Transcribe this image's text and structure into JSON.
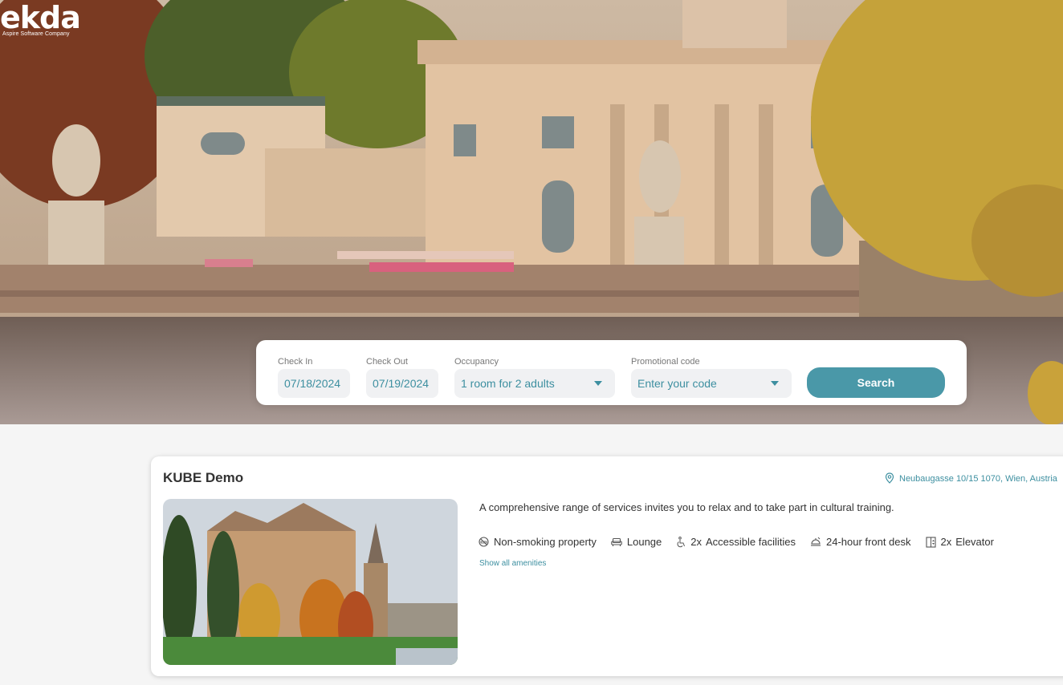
{
  "brand": {
    "wordmark": "ekda",
    "tagline": "Aspire Software Company"
  },
  "search": {
    "check_in": {
      "label": "Check In",
      "value": "07/18/2024"
    },
    "check_out": {
      "label": "Check Out",
      "value": "07/19/2024"
    },
    "occupancy": {
      "label": "Occupancy",
      "value": "1 room for 2 adults"
    },
    "promo": {
      "label": "Promotional code",
      "placeholder": "Enter your code"
    },
    "button_label": "Search"
  },
  "property": {
    "name": "KUBE Demo",
    "address": "Neubaugasse 10/15 1070, Wien, Austria",
    "description": "A comprehensive range of services invites you to relax and to take part in cultural training.",
    "amenities": [
      {
        "icon": "no-smoking-icon",
        "count": "",
        "label": "Non-smoking property"
      },
      {
        "icon": "sofa-icon",
        "count": "",
        "label": "Lounge"
      },
      {
        "icon": "wheelchair-icon",
        "count": "2x",
        "label": "Accessible facilities"
      },
      {
        "icon": "bell-desk-icon",
        "count": "",
        "label": "24-hour front desk"
      },
      {
        "icon": "elevator-icon",
        "count": "2x",
        "label": "Elevator"
      }
    ],
    "show_all_label": "Show all amenities"
  },
  "colors": {
    "accent": "#4a98a8",
    "link": "#3d8fa0",
    "field_bg": "#f0f1f3"
  }
}
